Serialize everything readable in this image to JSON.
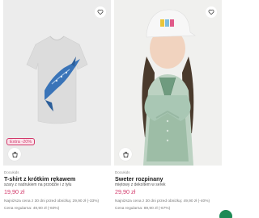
{
  "products": [
    {
      "sale_badge": "Extra -20%",
      "brand": "Docukids",
      "title": "T-shirt z krótkim rękawem",
      "description": "szary z nadrukiem na przodzie i z tyłu",
      "price": "19,90 zł",
      "lowest_price_note": "Najniższa cena z 30 dni przed obniżką: 29,90 zł (-33%)",
      "regular_price_note": "Cena regularna: 49,90 zł (-60%)"
    },
    {
      "brand": "Docukids",
      "title": "Sweter rozpinany",
      "description": "miętowy z dekoltem w serek",
      "price": "29,90 zł",
      "lowest_price_note": "Najniższa cena z 30 dni przed obniżką: 49,90 zł (-40%)",
      "regular_price_note": "Cena regularna: 89,90 zł (-67%)"
    }
  ],
  "colors": {
    "accent": "#d2386a",
    "image_bg": "#ececec"
  }
}
